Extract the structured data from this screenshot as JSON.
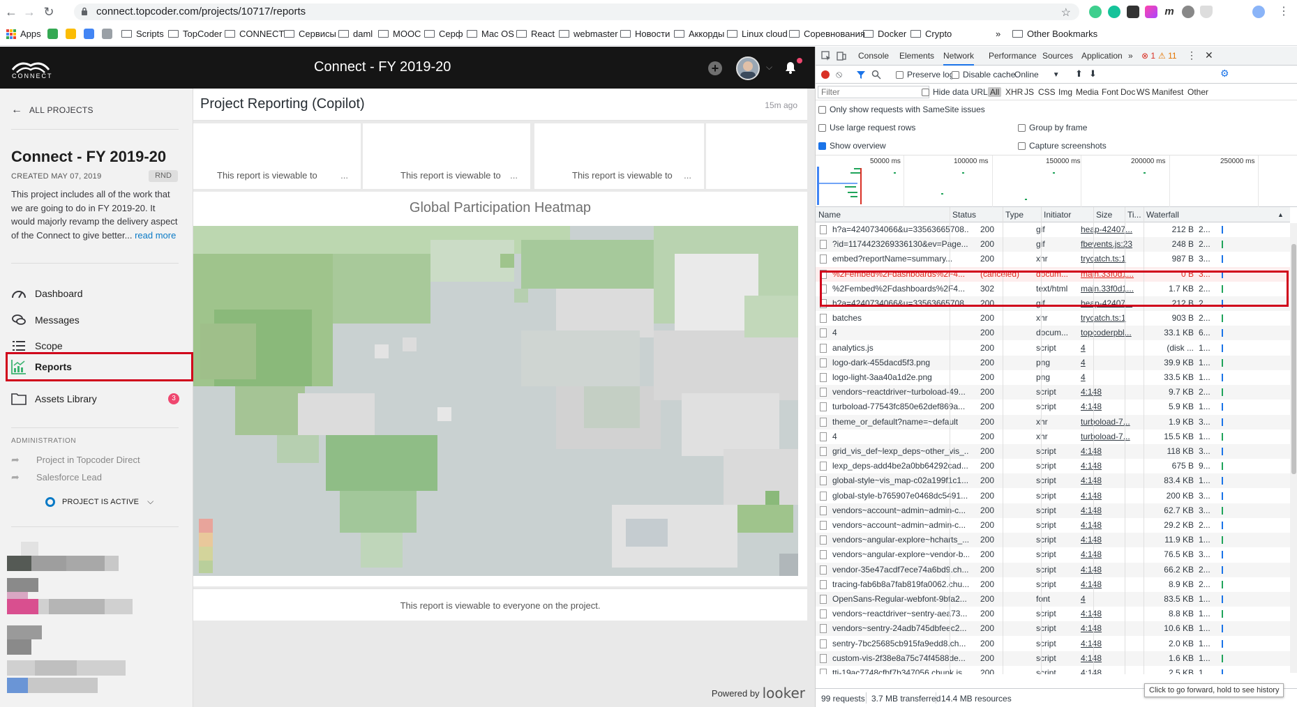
{
  "browser": {
    "url": "connect.topcoder.com/projects/10717/reports",
    "bookmarks": [
      "Apps",
      "Scripts",
      "TopCoder",
      "CONNECT",
      "Сервисы",
      "daml",
      "MOOC",
      "Серф",
      "Mac OS",
      "React",
      "webmaster",
      "Новости",
      "Аккорды",
      "Linux cloud",
      "Соревнования",
      "Docker",
      "Crypto"
    ],
    "other_bookmarks": "Other Bookmarks",
    "overflow": "»"
  },
  "app": {
    "logo_text": "CONNECT",
    "title": "Connect - FY 2019-20"
  },
  "sidebar": {
    "all_projects": "ALL PROJECTS",
    "project_name": "Connect - FY 2019-20",
    "created": "CREATED MAY 07, 2019",
    "badge": "RND",
    "description": "This project includes all of the work that we are going to do in FY 2019-20. It would majorly revamp the delivery aspect of the Connect to give better...",
    "read_more": "read more",
    "nav": [
      {
        "label": "Dashboard"
      },
      {
        "label": "Messages"
      },
      {
        "label": "Scope"
      },
      {
        "label": "Reports"
      },
      {
        "label": "Assets Library",
        "badge": "3"
      }
    ],
    "admin_heading": "ADMINISTRATION",
    "admin_links": [
      "Project in Topcoder Direct",
      "Salesforce Lead"
    ],
    "status": "PROJECT IS ACTIVE"
  },
  "report": {
    "title": "Project Reporting (Copilot)",
    "updated": "15m ago",
    "tiles": [
      "This report is viewable to",
      "This report is viewable to",
      "This report is viewable to"
    ],
    "tile_more": "...",
    "heatmap_title": "Global Participation Heatmap",
    "footer": "This report is viewable to everyone on the project.",
    "powered_by": "Powered by",
    "powered_brand": "looker"
  },
  "devtools": {
    "tabs": [
      "Console",
      "Elements",
      "Network",
      "Performance",
      "Sources",
      "Application"
    ],
    "active_tab": "Network",
    "more_tabs": "»",
    "errors": "1",
    "warnings": "11",
    "toolbar": {
      "preserve_log": "Preserve log",
      "disable_cache": "Disable cache",
      "throttle": "Online"
    },
    "filter_placeholder": "Filter",
    "hide_data_urls": "Hide data URLs",
    "filter_types": [
      "All",
      "XHR",
      "JS",
      "CSS",
      "Img",
      "Media",
      "Font",
      "Doc",
      "WS",
      "Manifest",
      "Other"
    ],
    "options": {
      "samesite": "Only show requests with SameSite issues",
      "large_rows": "Use large request rows",
      "group_by_frame": "Group by frame",
      "show_overview": "Show overview",
      "capture_screenshots": "Capture screenshots"
    },
    "overview_ticks": [
      "50000 ms",
      "100000 ms",
      "150000 ms",
      "200000 ms",
      "250000 ms"
    ],
    "columns": [
      "Name",
      "Status",
      "Type",
      "Initiator",
      "Size",
      "Ti...",
      "Waterfall"
    ],
    "rows": [
      {
        "name": "h?a=4240734066&u=33563665708...",
        "status": "200",
        "type": "gif",
        "initiator": "heap-42407...",
        "size": "212 B",
        "time": "2..."
      },
      {
        "name": "?id=1174423269336130&ev=Page...",
        "status": "200",
        "type": "gif",
        "initiator": "fbevents.js:23",
        "size": "248 B",
        "time": "2..."
      },
      {
        "name": "embed?reportName=summary...",
        "status": "200",
        "type": "xhr",
        "initiator": "trycatch.ts:1",
        "size": "987 B",
        "time": "3..."
      },
      {
        "name": "%2Fembed%2Fdashboards%2F4...",
        "status": "(canceled)",
        "type": "docum...",
        "initiator": "main.33f0d1...",
        "size": "0 B",
        "time": "3...",
        "error": true
      },
      {
        "name": "%2Fembed%2Fdashboards%2F4...",
        "status": "302",
        "type": "text/html",
        "initiator": "main.33f0d1...",
        "size": "1.7 KB",
        "time": "2..."
      },
      {
        "name": "h?a=4240734066&u=33563665708...",
        "status": "200",
        "type": "gif",
        "initiator": "heap-42407...",
        "size": "212 B",
        "time": "2..."
      },
      {
        "name": "batches",
        "status": "200",
        "type": "xhr",
        "initiator": "trycatch.ts:1",
        "size": "903 B",
        "time": "2..."
      },
      {
        "name": "4",
        "status": "200",
        "type": "docum...",
        "initiator": "topcoderpbl...",
        "size": "33.1 KB",
        "time": "6..."
      },
      {
        "name": "analytics.js",
        "status": "200",
        "type": "script",
        "initiator": "4",
        "size": "(disk ...",
        "time": "1..."
      },
      {
        "name": "logo-dark-455dacd5f3.png",
        "status": "200",
        "type": "png",
        "initiator": "4",
        "size": "39.9 KB",
        "time": "1..."
      },
      {
        "name": "logo-light-3aa40a1d2e.png",
        "status": "200",
        "type": "png",
        "initiator": "4",
        "size": "33.5 KB",
        "time": "1..."
      },
      {
        "name": "vendors~reactdriver~turboload-49...",
        "status": "200",
        "type": "script",
        "initiator": "4:148",
        "size": "9.7 KB",
        "time": "2..."
      },
      {
        "name": "turboload-77543fc850e62def869a...",
        "status": "200",
        "type": "script",
        "initiator": "4:148",
        "size": "5.9 KB",
        "time": "1..."
      },
      {
        "name": "theme_or_default?name=~default",
        "status": "200",
        "type": "xhr",
        "initiator": "turboload-7...",
        "size": "1.9 KB",
        "time": "3..."
      },
      {
        "name": "4",
        "status": "200",
        "type": "xhr",
        "initiator": "turboload-7...",
        "size": "15.5 KB",
        "time": "1..."
      },
      {
        "name": "grid_vis_def~lexp_deps~other_vis_...",
        "status": "200",
        "type": "script",
        "initiator": "4:148",
        "size": "118 KB",
        "time": "3..."
      },
      {
        "name": "lexp_deps-add4be2a0bb64292cad...",
        "status": "200",
        "type": "script",
        "initiator": "4:148",
        "size": "675 B",
        "time": "9..."
      },
      {
        "name": "global-style~vis_map-c02a199f1c1...",
        "status": "200",
        "type": "script",
        "initiator": "4:148",
        "size": "83.4 KB",
        "time": "1..."
      },
      {
        "name": "global-style-b765907e0468dc5491...",
        "status": "200",
        "type": "script",
        "initiator": "4:148",
        "size": "200 KB",
        "time": "3..."
      },
      {
        "name": "vendors~account~admin~admin-c...",
        "status": "200",
        "type": "script",
        "initiator": "4:148",
        "size": "62.7 KB",
        "time": "3..."
      },
      {
        "name": "vendors~account~admin~admin-c...",
        "status": "200",
        "type": "script",
        "initiator": "4:148",
        "size": "29.2 KB",
        "time": "2..."
      },
      {
        "name": "vendors~angular-explore~hcharts_...",
        "status": "200",
        "type": "script",
        "initiator": "4:148",
        "size": "11.9 KB",
        "time": "1..."
      },
      {
        "name": "vendors~angular-explore~vendor-b...",
        "status": "200",
        "type": "script",
        "initiator": "4:148",
        "size": "76.5 KB",
        "time": "3..."
      },
      {
        "name": "vendor-35e47acdf7ece74a6bd9.ch...",
        "status": "200",
        "type": "script",
        "initiator": "4:148",
        "size": "66.2 KB",
        "time": "2..."
      },
      {
        "name": "tracing-fab6b8a7fab819fa0062.chu...",
        "status": "200",
        "type": "script",
        "initiator": "4:148",
        "size": "8.9 KB",
        "time": "2..."
      },
      {
        "name": "OpenSans-Regular-webfont-9bfa2...",
        "status": "200",
        "type": "font",
        "initiator": "4",
        "size": "83.5 KB",
        "time": "1..."
      },
      {
        "name": "vendors~reactdriver~sentry-aea73...",
        "status": "200",
        "type": "script",
        "initiator": "4:148",
        "size": "8.8 KB",
        "time": "1..."
      },
      {
        "name": "vendors~sentry-24adb745dbfeec2...",
        "status": "200",
        "type": "script",
        "initiator": "4:148",
        "size": "10.6 KB",
        "time": "1..."
      },
      {
        "name": "sentry-7bc25685cb915fa9edd8.ch...",
        "status": "200",
        "type": "script",
        "initiator": "4:148",
        "size": "2.0 KB",
        "time": "1..."
      },
      {
        "name": "custom-vis-2f38e8a75c74f4588de...",
        "status": "200",
        "type": "script",
        "initiator": "4:148",
        "size": "1.6 KB",
        "time": "1..."
      },
      {
        "name": "tti-19ac7748cfbf7b347056.chunk.js",
        "status": "200",
        "type": "script",
        "initiator": "4:148",
        "size": "2.5 KB",
        "time": "1..."
      }
    ],
    "status_bar": {
      "requests": "99 requests",
      "transferred": "3.7 MB transferred",
      "resources": "14.4 MB resources"
    },
    "tooltip": "Click to go forward, hold to see history"
  },
  "colors": {
    "highlight_red": "#d0021b",
    "accent_blue": "#0a7ac6",
    "error_red": "#e0261b"
  }
}
